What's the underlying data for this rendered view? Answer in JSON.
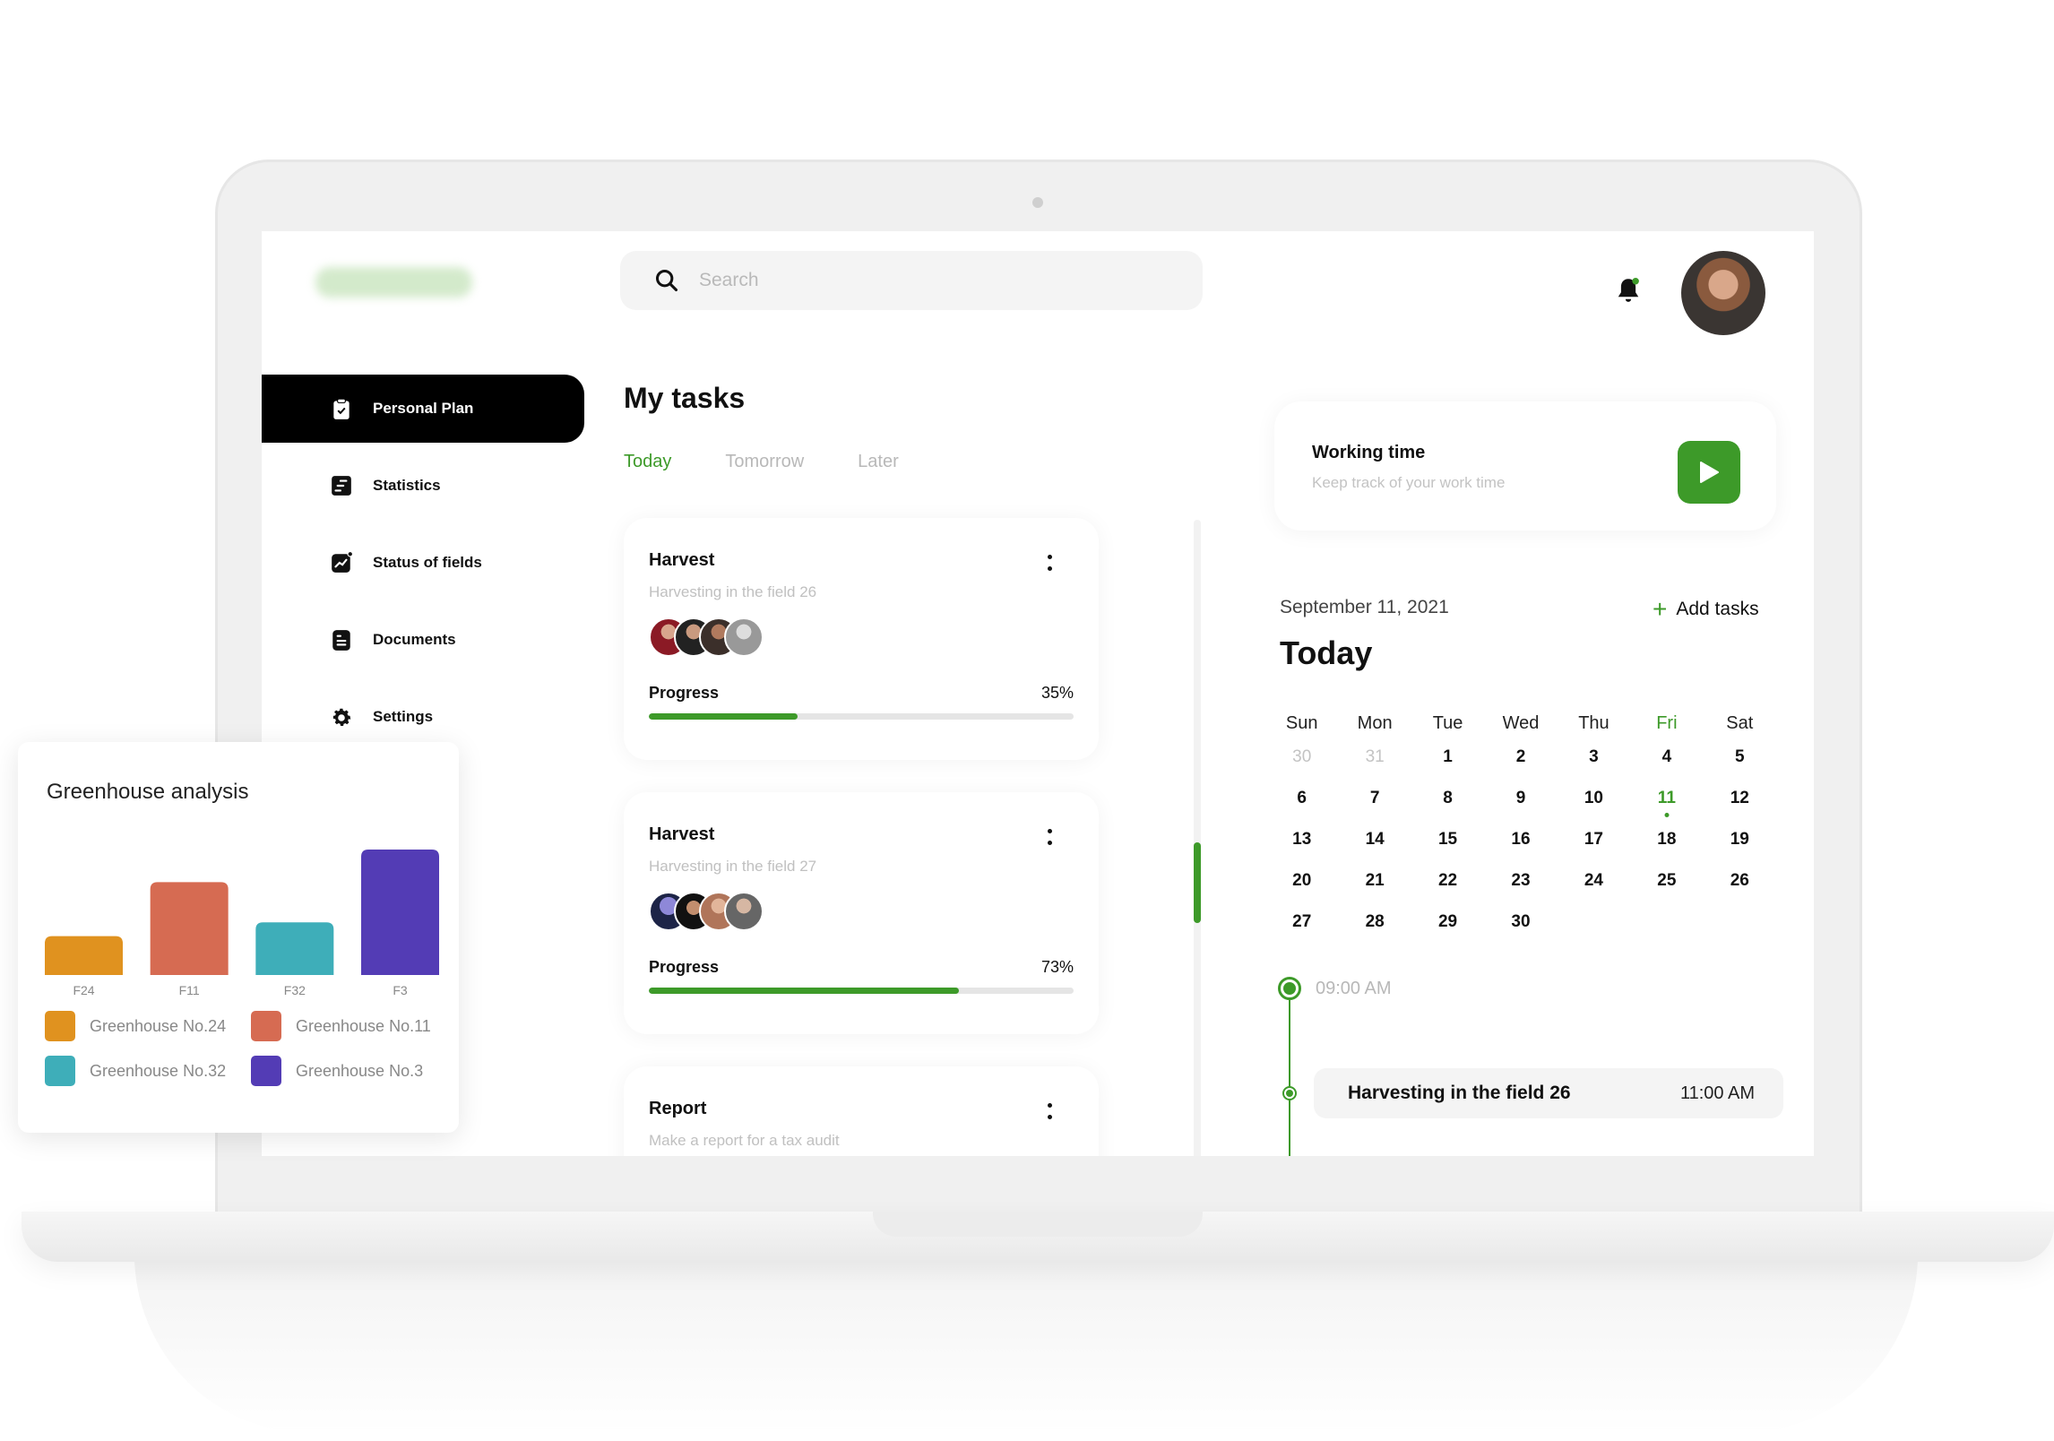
{
  "search": {
    "placeholder": "Search"
  },
  "header": {
    "notification_icon": "bell-icon",
    "avatar": "user-avatar"
  },
  "sidebar": {
    "items": [
      {
        "label": "Personal Plan",
        "icon": "clipboard-check-icon",
        "active": true
      },
      {
        "label": "Statistics",
        "icon": "statistics-icon",
        "active": false
      },
      {
        "label": "Status of fields",
        "icon": "chart-line-icon",
        "active": false
      },
      {
        "label": "Documents",
        "icon": "document-icon",
        "active": false
      },
      {
        "label": "Settings",
        "icon": "gear-icon",
        "active": false
      }
    ]
  },
  "tasks": {
    "title": "My tasks",
    "tabs": [
      {
        "label": "Today",
        "active": true
      },
      {
        "label": "Tomorrow",
        "active": false
      },
      {
        "label": "Later",
        "active": false
      }
    ],
    "progress_label": "Progress",
    "items": [
      {
        "title": "Harvest",
        "subtitle": "Harvesting in the field 26",
        "progress": 35,
        "progress_text": "35%"
      },
      {
        "title": "Harvest",
        "subtitle": "Harvesting in the field 27",
        "progress": 73,
        "progress_text": "73%"
      },
      {
        "title": "Report",
        "subtitle": "Make a report for a tax audit"
      }
    ]
  },
  "working_time": {
    "title": "Working time",
    "subtitle": "Keep track of your work time"
  },
  "calendar": {
    "date": "September 11, 2021",
    "add_label": "Add tasks",
    "title": "Today",
    "weekdays": [
      "Sun",
      "Mon",
      "Tue",
      "Wed",
      "Thu",
      "Fri",
      "Sat"
    ],
    "highlight_weekday": "Fri",
    "weeks": [
      [
        "30",
        "31",
        "1",
        "2",
        "3",
        "4",
        "5"
      ],
      [
        "6",
        "7",
        "8",
        "9",
        "10",
        "11",
        "12"
      ],
      [
        "13",
        "14",
        "15",
        "16",
        "17",
        "18",
        "19"
      ],
      [
        "20",
        "21",
        "22",
        "23",
        "24",
        "25",
        "26"
      ],
      [
        "27",
        "28",
        "29",
        "30",
        "",
        "",
        ""
      ]
    ],
    "muted_days": [
      "30",
      "31"
    ],
    "selected_day": "11"
  },
  "timeline": {
    "start_time": "09:00 AM",
    "events": [
      {
        "title": "Harvesting in the field 26",
        "time": "11:00 AM"
      }
    ]
  },
  "colors": {
    "accent": "#3d9a29",
    "active_nav_bg": "#000000"
  },
  "chart_data": {
    "type": "bar",
    "title": "Greenhouse analysis",
    "categories": [
      "F24",
      "F11",
      "F32",
      "F3"
    ],
    "values": [
      31,
      74,
      42,
      100
    ],
    "colors": [
      "#e0921f",
      "#d66b52",
      "#3eaeb9",
      "#533cb5"
    ],
    "xlabel": "",
    "ylabel": "",
    "ylim": [
      0,
      100
    ],
    "grid": false,
    "legend_position": "bottom",
    "legend": [
      "Greenhouse No.24",
      "Greenhouse No.11",
      "Greenhouse No.32",
      "Greenhouse No.3"
    ]
  }
}
